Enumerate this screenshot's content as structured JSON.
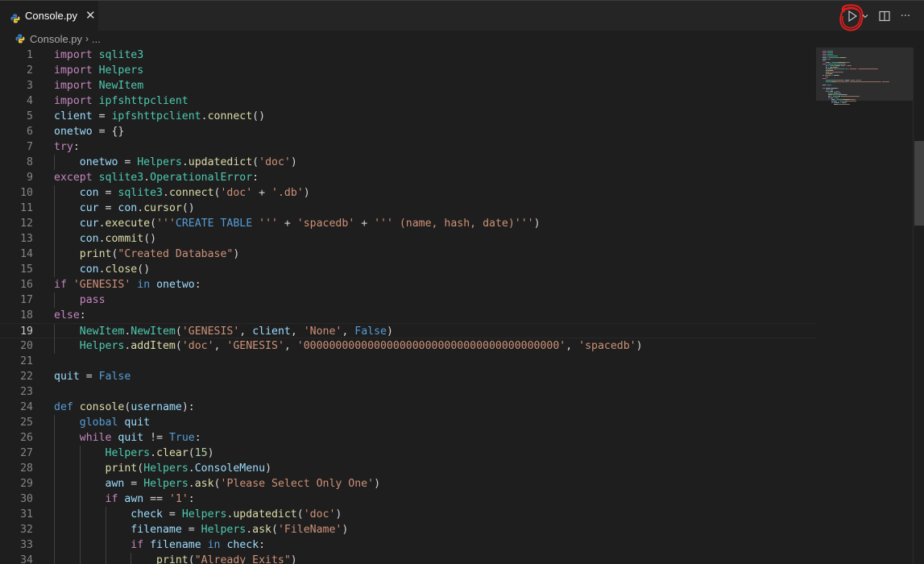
{
  "tab": {
    "label": "Console.py",
    "close": "✕"
  },
  "breadcrumb": {
    "file": "Console.py",
    "separator": "›",
    "more": "..."
  },
  "toolbar": {
    "run_icon": "play-icon",
    "dropdown_icon": "chevron-down-icon",
    "split_icon": "split-editor-icon",
    "more_label": "···"
  },
  "active_line": 19,
  "lines": [
    {
      "n": "1",
      "indent": 0,
      "t": [
        [
          "k",
          "import"
        ],
        [
          "p",
          " "
        ],
        [
          "m",
          "sqlite3"
        ]
      ]
    },
    {
      "n": "2",
      "indent": 0,
      "t": [
        [
          "k",
          "import"
        ],
        [
          "p",
          " "
        ],
        [
          "m",
          "Helpers"
        ]
      ]
    },
    {
      "n": "3",
      "indent": 0,
      "t": [
        [
          "k",
          "import"
        ],
        [
          "p",
          " "
        ],
        [
          "m",
          "NewItem"
        ]
      ]
    },
    {
      "n": "4",
      "indent": 0,
      "t": [
        [
          "k",
          "import"
        ],
        [
          "p",
          " "
        ],
        [
          "m",
          "ipfshttpclient"
        ]
      ]
    },
    {
      "n": "5",
      "indent": 0,
      "t": [
        [
          "v",
          "client"
        ],
        [
          "p",
          " = "
        ],
        [
          "m",
          "ipfshttpclient"
        ],
        [
          "p",
          "."
        ],
        [
          "f",
          "connect"
        ],
        [
          "p",
          "()"
        ]
      ]
    },
    {
      "n": "6",
      "indent": 0,
      "t": [
        [
          "v",
          "onetwo"
        ],
        [
          "p",
          " = {}"
        ]
      ]
    },
    {
      "n": "7",
      "indent": 0,
      "t": [
        [
          "k",
          "try"
        ],
        [
          "p",
          ":"
        ]
      ]
    },
    {
      "n": "8",
      "indent": 1,
      "t": [
        [
          "p",
          "    "
        ],
        [
          "v",
          "onetwo"
        ],
        [
          "p",
          " = "
        ],
        [
          "m",
          "Helpers"
        ],
        [
          "p",
          "."
        ],
        [
          "f",
          "updatedict"
        ],
        [
          "p",
          "("
        ],
        [
          "s",
          "'doc'"
        ],
        [
          "p",
          ")"
        ]
      ]
    },
    {
      "n": "9",
      "indent": 0,
      "t": [
        [
          "k",
          "except"
        ],
        [
          "p",
          " "
        ],
        [
          "m",
          "sqlite3"
        ],
        [
          "p",
          "."
        ],
        [
          "m",
          "OperationalError"
        ],
        [
          "p",
          ":"
        ]
      ]
    },
    {
      "n": "10",
      "indent": 1,
      "t": [
        [
          "p",
          "    "
        ],
        [
          "v",
          "con"
        ],
        [
          "p",
          " = "
        ],
        [
          "m",
          "sqlite3"
        ],
        [
          "p",
          "."
        ],
        [
          "f",
          "connect"
        ],
        [
          "p",
          "("
        ],
        [
          "s",
          "'doc'"
        ],
        [
          "p",
          " + "
        ],
        [
          "s",
          "'.db'"
        ],
        [
          "p",
          ")"
        ]
      ]
    },
    {
      "n": "11",
      "indent": 1,
      "t": [
        [
          "p",
          "    "
        ],
        [
          "v",
          "cur"
        ],
        [
          "p",
          " = "
        ],
        [
          "v",
          "con"
        ],
        [
          "p",
          "."
        ],
        [
          "f",
          "cursor"
        ],
        [
          "p",
          "()"
        ]
      ]
    },
    {
      "n": "12",
      "indent": 1,
      "t": [
        [
          "p",
          "    "
        ],
        [
          "v",
          "cur"
        ],
        [
          "p",
          "."
        ],
        [
          "f",
          "execute"
        ],
        [
          "p",
          "("
        ],
        [
          "s",
          "'''"
        ],
        [
          "kb",
          "CREATE TABLE"
        ],
        [
          "p",
          " "
        ],
        [
          "s",
          "'''"
        ],
        [
          "p",
          " + "
        ],
        [
          "s",
          "'spacedb'"
        ],
        [
          "p",
          " + "
        ],
        [
          "s",
          "''' (name, hash, date)'''"
        ],
        [
          "p",
          ")"
        ]
      ]
    },
    {
      "n": "13",
      "indent": 1,
      "t": [
        [
          "p",
          "    "
        ],
        [
          "v",
          "con"
        ],
        [
          "p",
          "."
        ],
        [
          "f",
          "commit"
        ],
        [
          "p",
          "()"
        ]
      ]
    },
    {
      "n": "14",
      "indent": 1,
      "t": [
        [
          "p",
          "    "
        ],
        [
          "f",
          "print"
        ],
        [
          "p",
          "("
        ],
        [
          "s",
          "\"Created Database\""
        ],
        [
          "p",
          ")"
        ]
      ]
    },
    {
      "n": "15",
      "indent": 1,
      "t": [
        [
          "p",
          "    "
        ],
        [
          "v",
          "con"
        ],
        [
          "p",
          "."
        ],
        [
          "f",
          "close"
        ],
        [
          "p",
          "()"
        ]
      ]
    },
    {
      "n": "16",
      "indent": 0,
      "t": [
        [
          "k",
          "if"
        ],
        [
          "p",
          " "
        ],
        [
          "s",
          "'GENESIS'"
        ],
        [
          "p",
          " "
        ],
        [
          "kb",
          "in"
        ],
        [
          "p",
          " "
        ],
        [
          "v",
          "onetwo"
        ],
        [
          "p",
          ":"
        ]
      ]
    },
    {
      "n": "17",
      "indent": 1,
      "t": [
        [
          "p",
          "    "
        ],
        [
          "k",
          "pass"
        ]
      ]
    },
    {
      "n": "18",
      "indent": 0,
      "t": [
        [
          "k",
          "else"
        ],
        [
          "p",
          ":"
        ]
      ]
    },
    {
      "n": "19",
      "indent": 1,
      "t": [
        [
          "p",
          "    "
        ],
        [
          "m",
          "NewItem"
        ],
        [
          "p",
          "."
        ],
        [
          "m",
          "NewItem"
        ],
        [
          "p",
          "("
        ],
        [
          "s",
          "'GENESIS'"
        ],
        [
          "p",
          ", "
        ],
        [
          "v",
          "client"
        ],
        [
          "p",
          ", "
        ],
        [
          "s",
          "'None'"
        ],
        [
          "p",
          ", "
        ],
        [
          "kb",
          "False"
        ],
        [
          "p",
          ")"
        ]
      ]
    },
    {
      "n": "20",
      "indent": 1,
      "t": [
        [
          "p",
          "    "
        ],
        [
          "m",
          "Helpers"
        ],
        [
          "p",
          "."
        ],
        [
          "f",
          "addItem"
        ],
        [
          "p",
          "("
        ],
        [
          "s",
          "'doc'"
        ],
        [
          "p",
          ", "
        ],
        [
          "s",
          "'GENESIS'"
        ],
        [
          "p",
          ", "
        ],
        [
          "s",
          "'0000000000000000000000000000000000000000'"
        ],
        [
          "p",
          ", "
        ],
        [
          "s",
          "'spacedb'"
        ],
        [
          "p",
          ")"
        ]
      ]
    },
    {
      "n": "21",
      "indent": 0,
      "t": []
    },
    {
      "n": "22",
      "indent": 0,
      "t": [
        [
          "v",
          "quit"
        ],
        [
          "p",
          " = "
        ],
        [
          "kb",
          "False"
        ]
      ]
    },
    {
      "n": "23",
      "indent": 0,
      "t": []
    },
    {
      "n": "24",
      "indent": 0,
      "t": [
        [
          "kb",
          "def"
        ],
        [
          "p",
          " "
        ],
        [
          "f",
          "console"
        ],
        [
          "p",
          "("
        ],
        [
          "v",
          "username"
        ],
        [
          "p",
          "):"
        ]
      ]
    },
    {
      "n": "25",
      "indent": 1,
      "t": [
        [
          "p",
          "    "
        ],
        [
          "kb",
          "global"
        ],
        [
          "p",
          " "
        ],
        [
          "v",
          "quit"
        ]
      ]
    },
    {
      "n": "26",
      "indent": 1,
      "t": [
        [
          "p",
          "    "
        ],
        [
          "k",
          "while"
        ],
        [
          "p",
          " "
        ],
        [
          "v",
          "quit"
        ],
        [
          "p",
          " != "
        ],
        [
          "kb",
          "True"
        ],
        [
          "p",
          ":"
        ]
      ]
    },
    {
      "n": "27",
      "indent": 2,
      "t": [
        [
          "p",
          "        "
        ],
        [
          "m",
          "Helpers"
        ],
        [
          "p",
          "."
        ],
        [
          "f",
          "clear"
        ],
        [
          "p",
          "("
        ],
        [
          "n",
          "15"
        ],
        [
          "p",
          ")"
        ]
      ]
    },
    {
      "n": "28",
      "indent": 2,
      "t": [
        [
          "p",
          "        "
        ],
        [
          "f",
          "print"
        ],
        [
          "p",
          "("
        ],
        [
          "m",
          "Helpers"
        ],
        [
          "p",
          "."
        ],
        [
          "v",
          "ConsoleMenu"
        ],
        [
          "p",
          ")"
        ]
      ]
    },
    {
      "n": "29",
      "indent": 2,
      "t": [
        [
          "p",
          "        "
        ],
        [
          "v",
          "awn"
        ],
        [
          "p",
          " = "
        ],
        [
          "m",
          "Helpers"
        ],
        [
          "p",
          "."
        ],
        [
          "f",
          "ask"
        ],
        [
          "p",
          "("
        ],
        [
          "s",
          "'Please Select Only One'"
        ],
        [
          "p",
          ")"
        ]
      ]
    },
    {
      "n": "30",
      "indent": 2,
      "t": [
        [
          "p",
          "        "
        ],
        [
          "k",
          "if"
        ],
        [
          "p",
          " "
        ],
        [
          "v",
          "awn"
        ],
        [
          "p",
          " == "
        ],
        [
          "s",
          "'1'"
        ],
        [
          "p",
          ":"
        ]
      ]
    },
    {
      "n": "31",
      "indent": 3,
      "t": [
        [
          "p",
          "            "
        ],
        [
          "v",
          "check"
        ],
        [
          "p",
          " = "
        ],
        [
          "m",
          "Helpers"
        ],
        [
          "p",
          "."
        ],
        [
          "f",
          "updatedict"
        ],
        [
          "p",
          "("
        ],
        [
          "s",
          "'doc'"
        ],
        [
          "p",
          ")"
        ]
      ]
    },
    {
      "n": "32",
      "indent": 3,
      "t": [
        [
          "p",
          "            "
        ],
        [
          "v",
          "filename"
        ],
        [
          "p",
          " = "
        ],
        [
          "m",
          "Helpers"
        ],
        [
          "p",
          "."
        ],
        [
          "f",
          "ask"
        ],
        [
          "p",
          "("
        ],
        [
          "s",
          "'FileName'"
        ],
        [
          "p",
          ")"
        ]
      ]
    },
    {
      "n": "33",
      "indent": 3,
      "t": [
        [
          "p",
          "            "
        ],
        [
          "k",
          "if"
        ],
        [
          "p",
          " "
        ],
        [
          "v",
          "filename"
        ],
        [
          "p",
          " "
        ],
        [
          "kb",
          "in"
        ],
        [
          "p",
          " "
        ],
        [
          "v",
          "check"
        ],
        [
          "p",
          ":"
        ]
      ]
    },
    {
      "n": "34",
      "indent": 4,
      "t": [
        [
          "p",
          "                "
        ],
        [
          "f",
          "print"
        ],
        [
          "p",
          "("
        ],
        [
          "s",
          "\"Already Exits\""
        ],
        [
          "p",
          ")"
        ]
      ]
    }
  ]
}
